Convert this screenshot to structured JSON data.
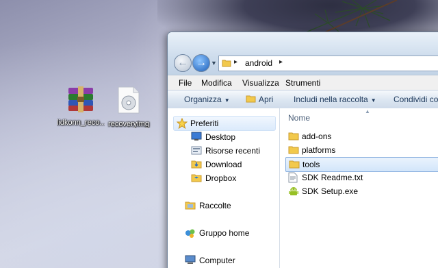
{
  "desktop": {
    "icons": [
      {
        "label": "lidkonn_reco...",
        "icon": "winrar-archive-icon"
      },
      {
        "label": "recoveryimg",
        "icon": "disc-image-file-icon"
      }
    ]
  },
  "window": {
    "address": {
      "path": [
        "android"
      ]
    },
    "menu": [
      "File",
      "Modifica",
      "Visualizza",
      "Strumenti"
    ],
    "commands": {
      "organize": "Organizza",
      "open": "Apri",
      "include": "Includi nella raccolta",
      "share": "Condividi con"
    },
    "nav_pane": {
      "favorites": "Preferiti",
      "favorite_items": [
        "Desktop",
        "Risorse recenti",
        "Download",
        "Dropbox"
      ],
      "libraries": "Raccolte",
      "homegroup": "Gruppo home",
      "computer": "Computer"
    },
    "content": {
      "column_name": "Nome",
      "files": [
        {
          "name": "add-ons",
          "type": "folder"
        },
        {
          "name": "platforms",
          "type": "folder"
        },
        {
          "name": "tools",
          "type": "folder",
          "selected": true
        },
        {
          "name": "SDK Readme.txt",
          "type": "text"
        },
        {
          "name": "SDK Setup.exe",
          "type": "exe"
        }
      ]
    }
  },
  "colors": {
    "selection_border": "#84acdd",
    "folder_yellow": "#f2c94c",
    "android_green": "#97c024"
  }
}
